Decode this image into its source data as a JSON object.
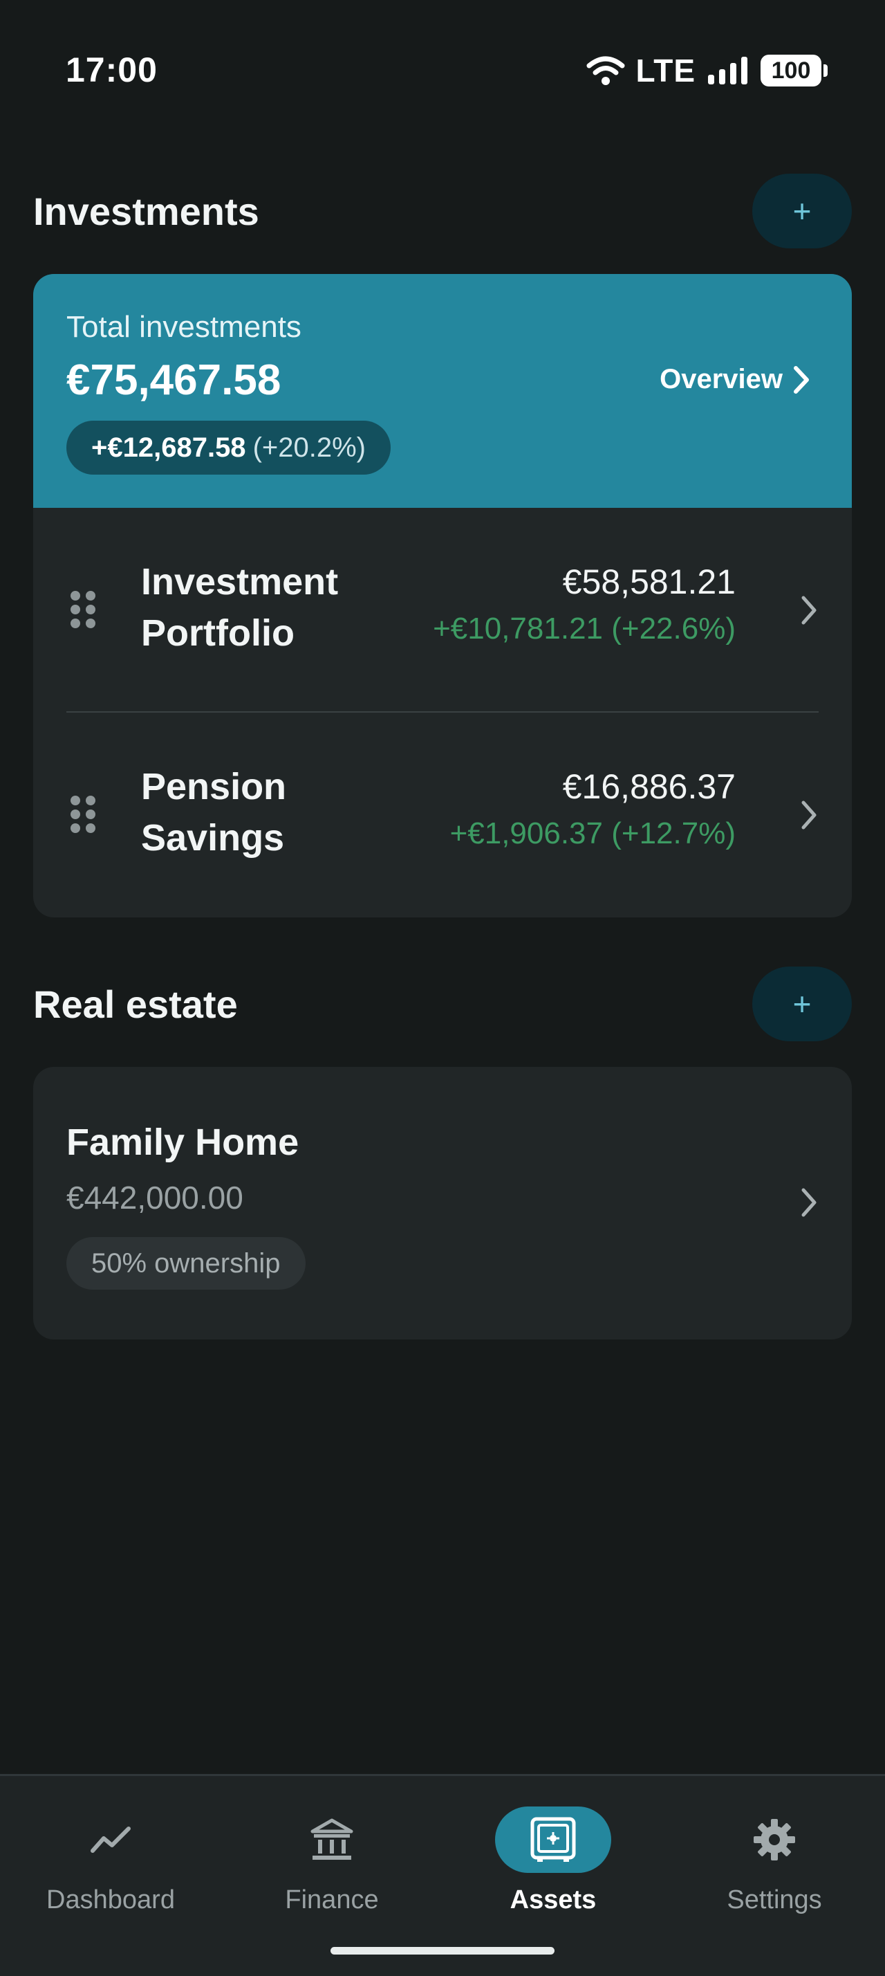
{
  "status": {
    "time": "17:00",
    "network": "LTE",
    "battery": "100"
  },
  "investments": {
    "title": "Investments",
    "add_label": "+",
    "total_label": "Total investments",
    "total_value": "€75,467.58",
    "overview_label": "Overview",
    "gain_amount": "+€12,687.58",
    "gain_percent": "(+20.2%)",
    "items": [
      {
        "name": "Investment Portfolio",
        "value": "€58,581.21",
        "change": "+€10,781.21 (+22.6%)"
      },
      {
        "name": "Pension Savings",
        "value": "€16,886.37",
        "change": "+€1,906.37 (+12.7%)"
      }
    ]
  },
  "real_estate": {
    "title": "Real estate",
    "add_label": "+",
    "items": [
      {
        "name": "Family Home",
        "value": "€442,000.00",
        "ownership": "50% ownership"
      }
    ]
  },
  "nav": {
    "active": "Assets",
    "items": [
      {
        "label": "Dashboard",
        "icon": "trend-line-icon"
      },
      {
        "label": "Finance",
        "icon": "bank-icon"
      },
      {
        "label": "Assets",
        "icon": "safe-icon"
      },
      {
        "label": "Settings",
        "icon": "gear-icon"
      }
    ]
  },
  "colors": {
    "background": "#161a1a",
    "card": "#212627",
    "accent": "#24879e",
    "positive": "#3d9b63"
  }
}
